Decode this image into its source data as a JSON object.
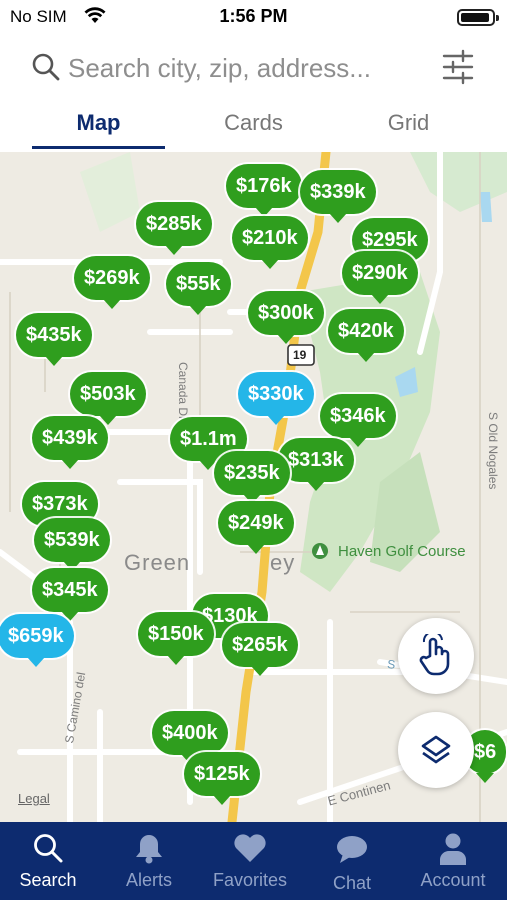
{
  "status": {
    "carrier": "No SIM",
    "time": "1:56 PM"
  },
  "search": {
    "placeholder": "Search city, zip, address..."
  },
  "tabs": [
    {
      "label": "Map",
      "active": true
    },
    {
      "label": "Cards",
      "active": false
    },
    {
      "label": "Grid",
      "active": false
    }
  ],
  "map": {
    "labels": {
      "place": "Green",
      "place_suffix": "ey",
      "golf": "Haven Golf Course",
      "legal": "Legal",
      "road_route": "19",
      "road_canada": "Canada Dr",
      "road_camino": "S Camino del",
      "road_nogales": "S Old Nogales",
      "road_continental": "E Continen",
      "road_von": "S       Von Wa"
    },
    "pins": [
      {
        "price": "$176k",
        "color": "green"
      },
      {
        "price": "$339k",
        "color": "green"
      },
      {
        "price": "$285k",
        "color": "green"
      },
      {
        "price": "$210k",
        "color": "green"
      },
      {
        "price": "$295k",
        "color": "green"
      },
      {
        "price": "$269k",
        "color": "green"
      },
      {
        "price": "$55k",
        "color": "green"
      },
      {
        "price": "$290k",
        "color": "green"
      },
      {
        "price": "$300k",
        "color": "green"
      },
      {
        "price": "$435k",
        "color": "green"
      },
      {
        "price": "$420k",
        "color": "green"
      },
      {
        "price": "$503k",
        "color": "green"
      },
      {
        "price": "$330k",
        "color": "blue"
      },
      {
        "price": "$346k",
        "color": "green"
      },
      {
        "price": "$439k",
        "color": "green"
      },
      {
        "price": "$1.1m",
        "color": "green"
      },
      {
        "price": "$313k",
        "color": "green"
      },
      {
        "price": "$235k",
        "color": "green"
      },
      {
        "price": "$373k",
        "color": "green"
      },
      {
        "price": "$249k",
        "color": "green"
      },
      {
        "price": "$539k",
        "color": "green"
      },
      {
        "price": "$345k",
        "color": "green"
      },
      {
        "price": "$130k",
        "color": "green"
      },
      {
        "price": "$659k",
        "color": "blue"
      },
      {
        "price": "$150k",
        "color": "green"
      },
      {
        "price": "$265k",
        "color": "green"
      },
      {
        "price": "$400k",
        "color": "green"
      },
      {
        "price": "$125k",
        "color": "green"
      },
      {
        "price": "$6",
        "color": "green"
      }
    ]
  },
  "nav": [
    {
      "label": "Search",
      "icon": "search-icon",
      "active": true
    },
    {
      "label": "Alerts",
      "icon": "bell-icon",
      "active": false
    },
    {
      "label": "Favorites",
      "icon": "heart-icon",
      "active": false
    },
    {
      "label": "Chat",
      "icon": "chat-bubble-icon",
      "active": false
    },
    {
      "label": "Account",
      "icon": "person-icon",
      "active": false
    }
  ],
  "colors": {
    "brand_navy": "#0d2b6f",
    "pin_green": "#2f9e1e",
    "pin_selected_blue": "#24b6e8",
    "highway_yellow": "#f3c64a",
    "map_bg": "#eeebe3",
    "park_green": "#cfe6c4"
  }
}
